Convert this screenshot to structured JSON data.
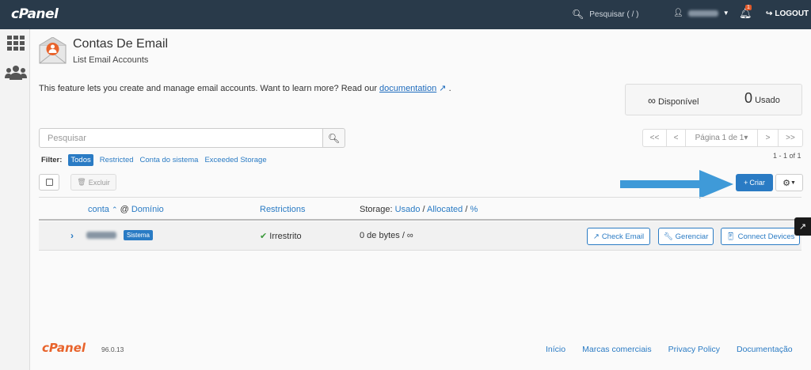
{
  "topbar": {
    "logo": "cPanel",
    "search_placeholder": "Pesquisar ( / )",
    "notification_count": "1",
    "logout_label": "LOGOUT"
  },
  "header": {
    "title": "Contas De Email",
    "subtitle": "List Email Accounts"
  },
  "intro": {
    "text": "This feature lets you create and manage email accounts. Want to learn more? Read our ",
    "link": "documentation",
    "suffix": "."
  },
  "stats": {
    "available_symbol": "∞",
    "available_label": "Disponível",
    "used_count": "0",
    "used_label": "Usado"
  },
  "search": {
    "placeholder": "Pesquisar"
  },
  "pager": {
    "first": "<<",
    "prev": "<",
    "page_label": "Página 1 de 1",
    "next": ">",
    "last": ">>",
    "range": "1 - 1 of 1"
  },
  "filter": {
    "label": "Filter:",
    "options": [
      "Todos",
      "Restricted",
      "Conta do sistema",
      "Exceeded Storage"
    ]
  },
  "toolbar": {
    "delete_label": "Excluir",
    "create_label": "Criar"
  },
  "table": {
    "col_account": "conta",
    "col_at": "@",
    "col_domain": "Domínio",
    "col_restrictions": "Restrictions",
    "col_storage_prefix": "Storage:",
    "col_storage_used": "Usado",
    "col_storage_allocated": "Allocated",
    "col_storage_pct": "%",
    "rows": [
      {
        "badge": "Sistema",
        "restriction": "Irrestrito",
        "storage": "0 de bytes / ∞",
        "actions": [
          "Check Email",
          "Gerenciar",
          "Connect Devices"
        ]
      }
    ]
  },
  "footer": {
    "logo": "cPanel",
    "version": "96.0.13",
    "links": [
      "Início",
      "Marcas comerciais",
      "Privacy Policy",
      "Documentação"
    ]
  },
  "colors": {
    "topbar": "#293a4a",
    "accent": "#2a7bc4",
    "brand_orange": "#e8632b",
    "arrow": "#3f9ad8"
  }
}
